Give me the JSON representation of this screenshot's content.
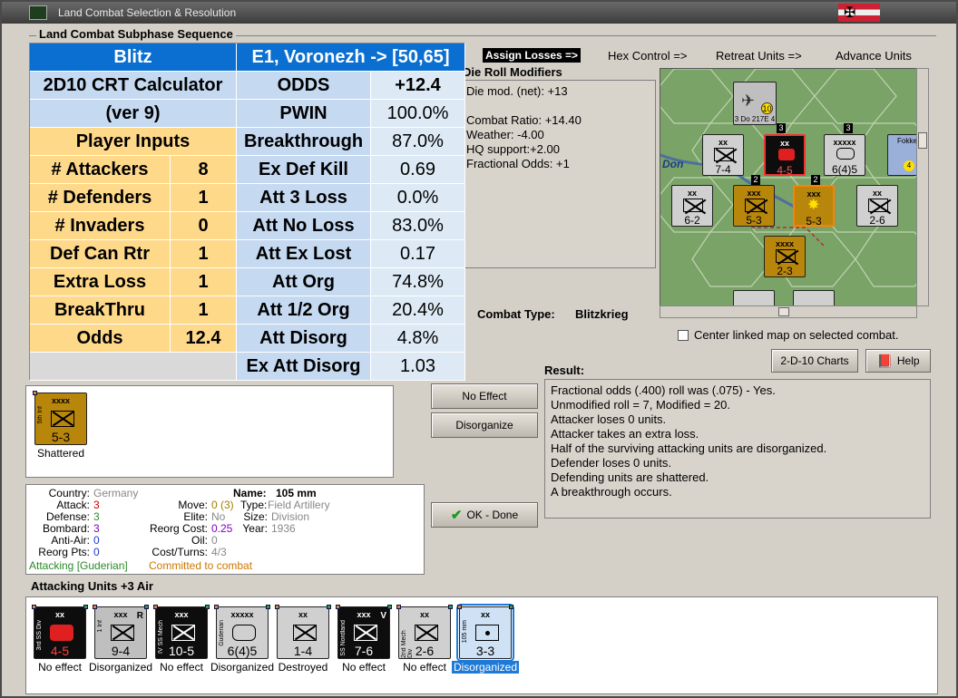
{
  "window": {
    "title": "Land Combat Selection & Resolution"
  },
  "group_title": "Land Combat Subphase Sequence",
  "steps": {
    "assign": "Assign Losses =>",
    "hex": "Hex Control =>",
    "retreat": "Retreat Units =>",
    "advance": "Advance Units"
  },
  "crt": {
    "blitz": "Blitz",
    "location": "E1, Voronezh -> [50,65]",
    "calc_title": "2D10 CRT Calculator",
    "calc_version": "(ver 9)",
    "player_inputs": "Player Inputs",
    "inputs": [
      {
        "label": "# Attackers",
        "value": "8"
      },
      {
        "label": "# Defenders",
        "value": "1"
      },
      {
        "label": "# Invaders",
        "value": "0"
      },
      {
        "label": "Def Can Rtr",
        "value": "1"
      },
      {
        "label": "Extra Loss",
        "value": "1"
      },
      {
        "label": "BreakThru",
        "value": "1"
      },
      {
        "label": "Odds",
        "value": "12.4"
      }
    ],
    "outputs": [
      {
        "label": "ODDS",
        "value": "+12.4"
      },
      {
        "label": "PWIN",
        "value": "100.0%"
      },
      {
        "label": "Breakthrough",
        "value": "87.0%"
      },
      {
        "label": "Ex Def Kill",
        "value": "0.69"
      },
      {
        "label": "Att 3 Loss",
        "value": "0.0%"
      },
      {
        "label": "Att No Loss",
        "value": "83.0%"
      },
      {
        "label": "Att Ex Lost",
        "value": "0.17"
      },
      {
        "label": "Att Org",
        "value": "74.8%"
      },
      {
        "label": "Att 1/2 Org",
        "value": "20.4%"
      },
      {
        "label": "Att Disorg",
        "value": "4.8%"
      },
      {
        "label": "Ex Att Disorg",
        "value": "1.03"
      }
    ]
  },
  "modifiers": {
    "title": "Die Roll Modifiers",
    "lines": [
      "Die mod. (net): +13",
      "",
      "Combat Ratio: +14.40",
      "Weather: -4.00",
      "HQ support:+2.00",
      "Fractional Odds: +1"
    ]
  },
  "combat_type": {
    "label": "Combat Type:",
    "value": "Blitzkrieg"
  },
  "center_map": "Center linked map on selected combat.",
  "buttons": {
    "charts": "2-D-10 Charts",
    "help": "Help",
    "no_effect": "No Effect",
    "disorganize": "Disorganize",
    "ok": "OK - Done"
  },
  "result": {
    "label": "Result:",
    "lines": [
      "Fractional odds (.400) roll was (.075)  - Yes.",
      "Unmodified roll = 7, Modified = 20.",
      "Attacker loses 0 units.",
      "Attacker takes an extra loss.",
      "Half of the surviving attacking units are disorganized.",
      "Defender loses 0 units.",
      "Defending units are shattered.",
      "A breakthrough occurs."
    ]
  },
  "defender": {
    "size": "xxxx",
    "name": "5th Inf",
    "strength": "5-3",
    "status": "Shattered"
  },
  "unit_info": {
    "country_label": "Country:",
    "country": "Germany",
    "attack_label": "Attack:",
    "attack": "3",
    "defense_label": "Defense:",
    "defense": "3",
    "bombard_label": "Bombard:",
    "bombard": "3",
    "antiair_label": "Anti-Air:",
    "antiair": "0",
    "reorg_label": "Reorg Pts:",
    "reorg": "0",
    "name_label": "Name:",
    "name": "105 mm",
    "move_label": "Move:",
    "move": "0 (3)",
    "type_label": "Type:",
    "type": "Field Artillery",
    "elite_label": "Elite:",
    "elite": "No",
    "size_label": "Size:",
    "size": "Division",
    "reorgcost_label": "Reorg Cost:",
    "reorgcost": "0.25",
    "year_label": "Year:",
    "year": "1936",
    "oil_label": "Oil:",
    "oil": "0",
    "cost_label": "Cost/Turns:",
    "cost": "4/3",
    "attacking": "Attacking [Guderian]",
    "committed": "Committed to combat"
  },
  "attacking_label": "Attacking Units +3 Air",
  "attackers": [
    {
      "size": "xx",
      "name": "3rd SS Div",
      "strength": "4-5",
      "status": "No effect",
      "style": "black",
      "sym": "arm"
    },
    {
      "size": "xxx",
      "name": "1 Inf",
      "strength": "9-4",
      "status": "Disorganized",
      "style": "grey",
      "sym": "inf",
      "mark": "R"
    },
    {
      "size": "xxx",
      "name": "IV SS Mech",
      "strength": "10-5",
      "status": "No effect",
      "style": "black",
      "sym": "inf"
    },
    {
      "size": "xxxxx",
      "name": "Guderian",
      "strength": "6(4)5",
      "status": "Disorganized",
      "style": "lgrey",
      "sym": "arm"
    },
    {
      "size": "xx",
      "name": "",
      "strength": "1-4",
      "status": "Destroyed",
      "style": "lgrey",
      "sym": "inf"
    },
    {
      "size": "xxx",
      "name": "SS Nordland",
      "strength": "7-6",
      "status": "No effect",
      "style": "black",
      "sym": "inf",
      "mark": "V"
    },
    {
      "size": "xx",
      "name": "2nd Mech Div",
      "strength": "2-6",
      "status": "No effect",
      "style": "lgrey",
      "sym": "inf"
    },
    {
      "size": "xx",
      "name": "105 mm",
      "strength": "3-3",
      "status": "Disorganized",
      "style": "lblue",
      "sym": "art"
    }
  ],
  "map": {
    "label_don": "Don",
    "air_unit": {
      "strength": "3 Do 217E 4",
      "badge": "10"
    },
    "fighter": {
      "name": "Fokke",
      "badge": "4"
    },
    "counters": [
      {
        "size": "xx",
        "strength": "7-4"
      },
      {
        "size": "xx",
        "strength": "4-5"
      },
      {
        "size": "xxxxx",
        "strength": "6(4)5"
      },
      {
        "size": "xxx",
        "strength": "5-3"
      },
      {
        "size": "xxx",
        "strength": "5-3"
      },
      {
        "size": "xx",
        "strength": "6-2"
      },
      {
        "size": "xx",
        "strength": "2-6"
      },
      {
        "size": "xxxx",
        "strength": "2-3"
      }
    ],
    "stack_badges": [
      "3",
      "2",
      "2",
      "3"
    ]
  },
  "colors": {
    "crt_blue": "#0a6fd0",
    "crt_yellow": "#ffd98a",
    "attack_green": "#2a8a2a",
    "committed_orange": "#cc7700",
    "attack_red": "#d00000",
    "bombard_purple": "#8000c0"
  }
}
